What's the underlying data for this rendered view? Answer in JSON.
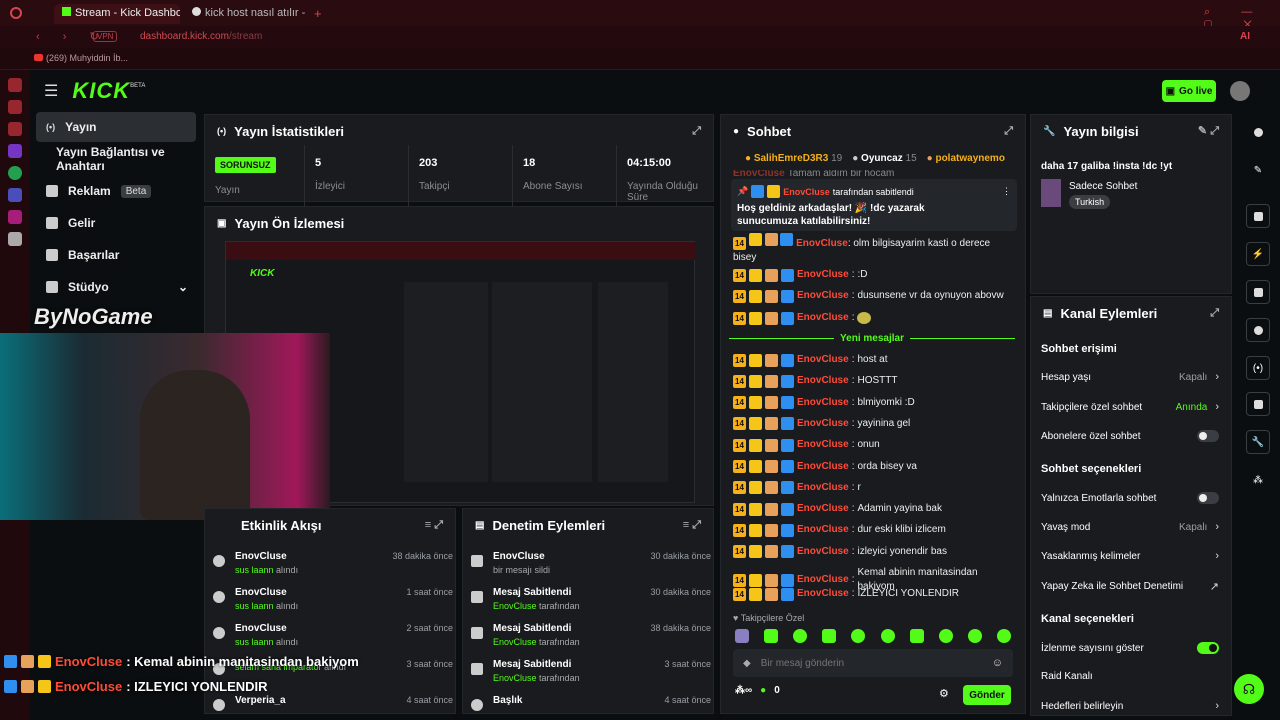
{
  "browser": {
    "tabs": [
      {
        "label": "Stream - Kick Dashboard"
      },
      {
        "label": "kick host nasıl atılır - Goog"
      }
    ],
    "url_host": "dashboard.kick.com",
    "url_path": "/stream",
    "vpn": "VPN",
    "bookmark": "(269) Muhyiddin İb...",
    "ai": "AI"
  },
  "app": {
    "logo": "KICK",
    "logo_sup": "BETA",
    "go_live": "Go live"
  },
  "sidebar": {
    "items": [
      {
        "label": "Yayın",
        "icon": "broadcast-icon"
      },
      {
        "label": "Yayın Bağlantısı ve Anahtarı",
        "icon": ""
      },
      {
        "label": "Reklam",
        "icon": "ad-icon",
        "badge": "Beta"
      },
      {
        "label": "Gelir",
        "icon": "chart-icon"
      },
      {
        "label": "Başarılar",
        "icon": "trophy-icon"
      },
      {
        "label": "Stüdyo",
        "icon": "studio-icon"
      }
    ]
  },
  "stats": {
    "title": "Yayın İstatistikleri",
    "status": "SORUNSUZ",
    "status_label": "Yayın",
    "cells": [
      {
        "value": "5",
        "label": "İzleyici"
      },
      {
        "value": "203",
        "label": "Takipçi"
      },
      {
        "value": "18",
        "label": "Abone Sayısı"
      },
      {
        "value": "04:15:00",
        "label": "Yayında Olduğu Süre"
      }
    ]
  },
  "preview": {
    "title": "Yayın Ön İzlemesi"
  },
  "activity": {
    "title": "Etkinlik Akışı",
    "rows": [
      {
        "name": "EnovCluse",
        "sub_b": "sus laann",
        "sub": "alındı",
        "time": "38 dakika önce"
      },
      {
        "name": "EnovCluse",
        "sub_b": "sus laann",
        "sub": "alındı",
        "time": "1 saat önce"
      },
      {
        "name": "EnovCluse",
        "sub_b": "sus laann",
        "sub": "alındı",
        "time": "2 saat önce"
      },
      {
        "name": "",
        "sub_b": "selam sana imparator",
        "sub": "alındı",
        "time": "3 saat önce"
      },
      {
        "name": "Verperia_a",
        "sub_b": "",
        "sub": "",
        "time": "4 saat önce"
      }
    ]
  },
  "moderation": {
    "title": "Denetim Eylemleri",
    "rows": [
      {
        "name": "EnovCluse",
        "sub_b": "",
        "sub": "bir mesajı sildi",
        "time": "30 dakika önce"
      },
      {
        "name": "Mesaj Sabitlendi",
        "sub_b": "EnovCluse",
        "sub": "tarafından",
        "time": "30 dakika önce"
      },
      {
        "name": "Mesaj Sabitlendi",
        "sub_b": "EnovCluse",
        "sub": "tarafından",
        "time": "38 dakika önce"
      },
      {
        "name": "Mesaj Sabitlendi",
        "sub_b": "EnovCluse",
        "sub": "tarafından",
        "time": "3 saat önce"
      },
      {
        "name": "Başlık",
        "sub_b": "",
        "sub": "",
        "time": "4 saat önce"
      }
    ]
  },
  "chat": {
    "title": "Sohbet",
    "top_users": [
      {
        "name": "SalihEmreD3R3",
        "count": "19"
      },
      {
        "name": "Oyuncaz",
        "count": "15"
      },
      {
        "name": "polatwaynemo",
        "count": ""
      }
    ],
    "partial_line": "Tamam aldım bir hocam",
    "pinned_by": "EnovCluse",
    "pinned_suffix": "tarafından sabitlendi",
    "pinned_text": "Hoş geldiniz arkadaşlar! 🎉 !dc yazarak sunucumuza katılabilirsiniz!",
    "new_messages": "Yeni mesajlar",
    "messages_before": [
      {
        "user": "EnovCluse",
        "text": "olm bilgisayarim kasti o derece bisey"
      },
      {
        "user": "EnovCluse",
        "text": ":D"
      },
      {
        "user": "EnovCluse",
        "text": "dusunsene vr da oynuyon abovw"
      },
      {
        "user": "EnovCluse",
        "text": ""
      }
    ],
    "messages_after": [
      {
        "user": "EnovCluse",
        "text": "host at"
      },
      {
        "user": "EnovCluse",
        "text": "HOSTTT"
      },
      {
        "user": "EnovCluse",
        "text": "blmiyomki :D"
      },
      {
        "user": "EnovCluse",
        "text": "yayinina gel"
      },
      {
        "user": "EnovCluse",
        "text": "onun"
      },
      {
        "user": "EnovCluse",
        "text": "orda bisey va"
      },
      {
        "user": "EnovCluse",
        "text": "r"
      },
      {
        "user": "EnovCluse",
        "text": "Adamin yayina bak"
      },
      {
        "user": "EnovCluse",
        "text": "dur eski klibi izlicem"
      },
      {
        "user": "EnovCluse",
        "text": "izleyici yonendir bas"
      },
      {
        "user": "EnovCluse",
        "text": "Kemal abinin manitasindan bakiyom"
      },
      {
        "user": "EnovCluse",
        "text": "IZLEYICI YONLENDIR"
      }
    ],
    "followers_only": "Takipçilere Özel",
    "input_placeholder": "Bir mesaj gönderin",
    "points": "0",
    "send": "Gönder"
  },
  "stream_info": {
    "title": "Yayın bilgisi",
    "stream_title": "daha 17 galiba !insta !dc !yt",
    "category": "Sadece Sohbet",
    "language": "Turkish"
  },
  "channel_actions": {
    "title": "Kanal Eylemleri",
    "chat_access": "Sohbet erişimi",
    "rows1": [
      {
        "label": "Hesap yaşı",
        "value": "Kapalı",
        "type": "chevron"
      },
      {
        "label": "Takipçilere özel sohbet",
        "value": "Anında",
        "type": "chevron-green"
      },
      {
        "label": "Abonelere özel sohbet",
        "value": "",
        "type": "toggle-off"
      }
    ],
    "chat_options": "Sohbet seçenekleri",
    "rows2": [
      {
        "label": "Yalnızca Emotlarla sohbet",
        "value": "",
        "type": "toggle-off"
      },
      {
        "label": "Yavaş mod",
        "value": "Kapalı",
        "type": "chevron"
      },
      {
        "label": "Yasaklanmış kelimeler",
        "value": "",
        "type": "chevron"
      },
      {
        "label": "Yapay Zeka ile Sohbet Denetimi",
        "value": "",
        "type": "external"
      }
    ],
    "channel_options": "Kanal seçenekleri",
    "rows3": [
      {
        "label": "İzlenme sayısını göster",
        "value": "",
        "type": "toggle-on"
      },
      {
        "label": "Raid Kanalı",
        "value": "",
        "type": "none"
      },
      {
        "label": "Hedefleri belirleyin",
        "value": "",
        "type": "chevron"
      }
    ]
  },
  "overlay": {
    "watermark": "ByNoGame",
    "lines": [
      {
        "user": "EnovCluse",
        "text": ": Kemal abinin manitasindan bakiyom"
      },
      {
        "user": "EnovCluse",
        "text": ": IZLEYICI YONLENDIR"
      }
    ]
  },
  "colors": {
    "accent": "#53fc18",
    "username": "#ff4b38",
    "panel": "#191b1f",
    "bg": "#0b0e10"
  }
}
